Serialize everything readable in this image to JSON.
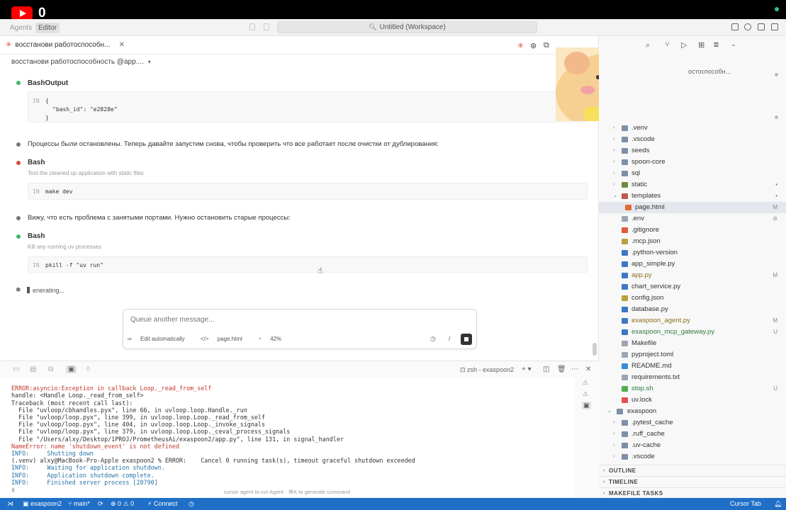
{
  "topbar": {
    "yt_count": "0"
  },
  "titlebar": {
    "agents_label": "Agents",
    "editor_label": "Editor",
    "workspace_title": "Untitled (Workspace)"
  },
  "chat": {
    "tab_title": "восстанови работоспособн...",
    "subtitle": "восстанови работоспособность @app....",
    "msg1": {
      "tool": "BashOutput",
      "code_line1": "{",
      "code_line2": "\"bash_id\": \"e2828e\"",
      "code_line3": "}"
    },
    "msg2_text": "Процессы были остановлены. Теперь давайте запустим снова, чтобы проверить что все работает после очистки от дублирования:",
    "msg3": {
      "tool": "Bash",
      "desc": "Test the cleaned up application with static files",
      "command": "make dev"
    },
    "msg4_text": "Вижу, что есть проблема с занятыми портами. Нужно остановить старые процессы:",
    "msg5": {
      "tool": "Bash",
      "desc": "Kill any running uv processes",
      "command": "pkill -f \"uv run\""
    },
    "generating": "enerating...",
    "in_label": "IN",
    "composer": {
      "placeholder": "Queue another message...",
      "edit_mode": "Edit automatically",
      "context_file": "page.html",
      "context_pct": "42%"
    }
  },
  "terminal": {
    "shell_label": "zsh - exaspoon2",
    "lines": [
      "ERROR:asyncio:Exception in callback Loop._read_from_self",
      "handle: <Handle Loop._read_from_self>",
      "Traceback (most recent call last):",
      "  File \"uvloop/cbhandles.pyx\", line 66, in uvloop.loop.Handle._run",
      "  File \"uvloop/loop.pyx\", line 399, in uvloop.loop.Loop._read_from_self",
      "  File \"uvloop/loop.pyx\", line 404, in uvloop.loop.Loop._invoke_signals",
      "  File \"uvloop/loop.pyx\", line 379, in uvloop.loop.Loop._ceval_process_signals",
      "  File \"/Users/alxy/Desktop/1PROJ/PrometheusAi/exaspoon2/app.py\", line 131, in signal_handler",
      "NameError: name 'shutdown_event' is not defined",
      "INFO:     Shutting down",
      "(.venv) alxy@MacBook-Pro-Apple exaspoon2 % ERROR:    Cancel 0 running task(s), timeout graceful shutdown exceeded",
      "INFO:     Waiting for application shutdown.",
      "INFO:     Application shutdown complete.",
      "INFO:     Finished server process [28790]",
      "▯"
    ],
    "hint": "cursor  agent to run Agent · ⌘K to generate command"
  },
  "explorer": {
    "header_crumb": "остоспособн...",
    "items": [
      {
        "label": ".venv",
        "type": "folder",
        "status": ""
      },
      {
        "label": ".vscode",
        "type": "folder",
        "status": ""
      },
      {
        "label": "seeds",
        "type": "folder",
        "status": ""
      },
      {
        "label": "spoon-core",
        "type": "folder",
        "status": ""
      },
      {
        "label": "sql",
        "type": "folder",
        "status": ""
      },
      {
        "label": "static",
        "type": "folder",
        "status": "•"
      },
      {
        "label": "templates",
        "type": "folder",
        "status": "•"
      },
      {
        "label": "page.html",
        "type": "file",
        "status": "M"
      },
      {
        "label": ".env",
        "type": "file",
        "status": "⊘"
      },
      {
        "label": ".gitignore",
        "type": "file",
        "status": ""
      },
      {
        "label": ".mcp.json",
        "type": "file",
        "status": ""
      },
      {
        "label": ".python-version",
        "type": "file",
        "status": ""
      },
      {
        "label": "app_simple.py",
        "type": "file",
        "status": ""
      },
      {
        "label": "app.py",
        "type": "file",
        "status": "M"
      },
      {
        "label": "chart_service.py",
        "type": "file",
        "status": ""
      },
      {
        "label": "config.json",
        "type": "file",
        "status": ""
      },
      {
        "label": "database.py",
        "type": "file",
        "status": ""
      },
      {
        "label": "exaspoon_agent.py",
        "type": "file",
        "status": "M"
      },
      {
        "label": "exaspoon_mcp_gateway.py",
        "type": "file",
        "status": "U"
      },
      {
        "label": "Makefile",
        "type": "file",
        "status": ""
      },
      {
        "label": "pyproject.toml",
        "type": "file",
        "status": ""
      },
      {
        "label": "README.md",
        "type": "file",
        "status": ""
      },
      {
        "label": "requirements.txt",
        "type": "file",
        "status": ""
      },
      {
        "label": "stop.sh",
        "type": "file",
        "status": "U"
      },
      {
        "label": "uv.lock",
        "type": "file",
        "status": ""
      },
      {
        "label": "exaspoon",
        "type": "folder",
        "status": ""
      },
      {
        "label": ".pytest_cache",
        "type": "folder",
        "status": ""
      },
      {
        "label": ".ruff_cache",
        "type": "folder",
        "status": ""
      },
      {
        "label": ".uv-cache",
        "type": "folder",
        "status": ""
      },
      {
        "label": ".vscode",
        "type": "folder",
        "status": ""
      }
    ],
    "sections": [
      "OUTLINE",
      "TIMELINE",
      "MAKEFILE TASKS"
    ]
  },
  "statusbar": {
    "repo": "exaspoon2",
    "branch": "main*",
    "errors": "0",
    "warnings": "0",
    "connect": "Connect",
    "right_label": "Cursor Tab"
  },
  "colors": {
    "accent": "#1f6fc7",
    "brand_red": "#ff0000",
    "error_red": "#c0392b"
  }
}
